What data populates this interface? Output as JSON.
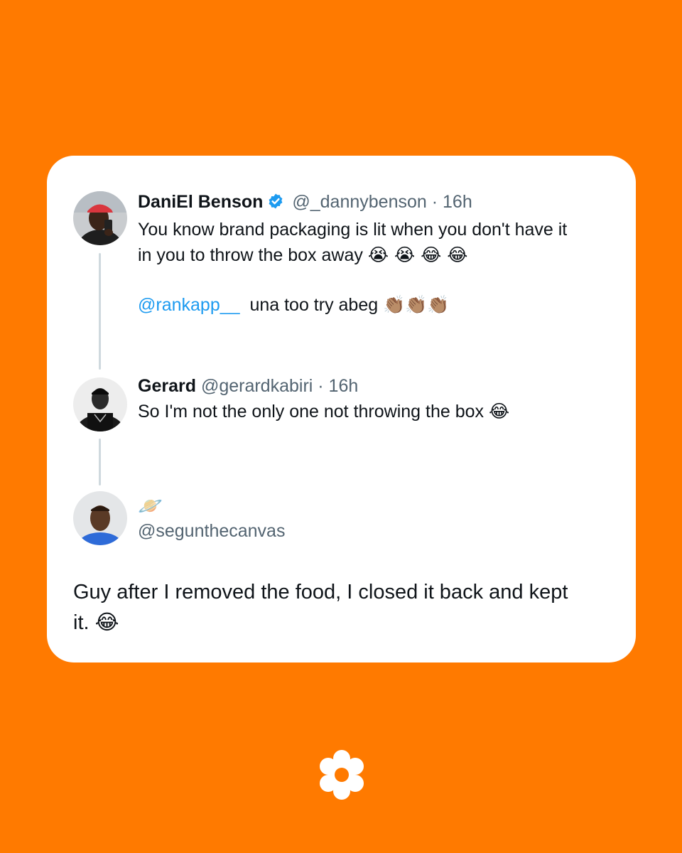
{
  "tweets": [
    {
      "name": "DaniEl Benson",
      "handle": "@_dannybenson",
      "time": "· 16h",
      "verified": true,
      "line1": "You know brand packaging is lit when you don't have it",
      "line2": "in you to throw the box away",
      "line2_emoji": "😭 😭 😂 😂",
      "mention": "@rankapp__",
      "line3": "una too try abeg",
      "line3_emoji": "👏🏽👏🏽👏🏽"
    },
    {
      "name": "Gerard",
      "handle": "@gerardkabiri",
      "time": "· 16h",
      "text": "So I'm not the only one not throwing the box",
      "emoji": "😂"
    },
    {
      "name_emoji": "🪐",
      "handle": "@segunthecanvas",
      "line1": "Guy after I removed the food, I closed it back and kept",
      "line2": "it.",
      "emoji": "😂"
    }
  ],
  "colors": {
    "background": "#FF7A00",
    "card": "#FFFFFF",
    "mention": "#1D9BF0",
    "verified": "#1D9BF0",
    "thread_line": "#CFD9DE"
  },
  "icons": {
    "verified": "verified-badge-icon",
    "brand": "flower-logo-icon"
  }
}
